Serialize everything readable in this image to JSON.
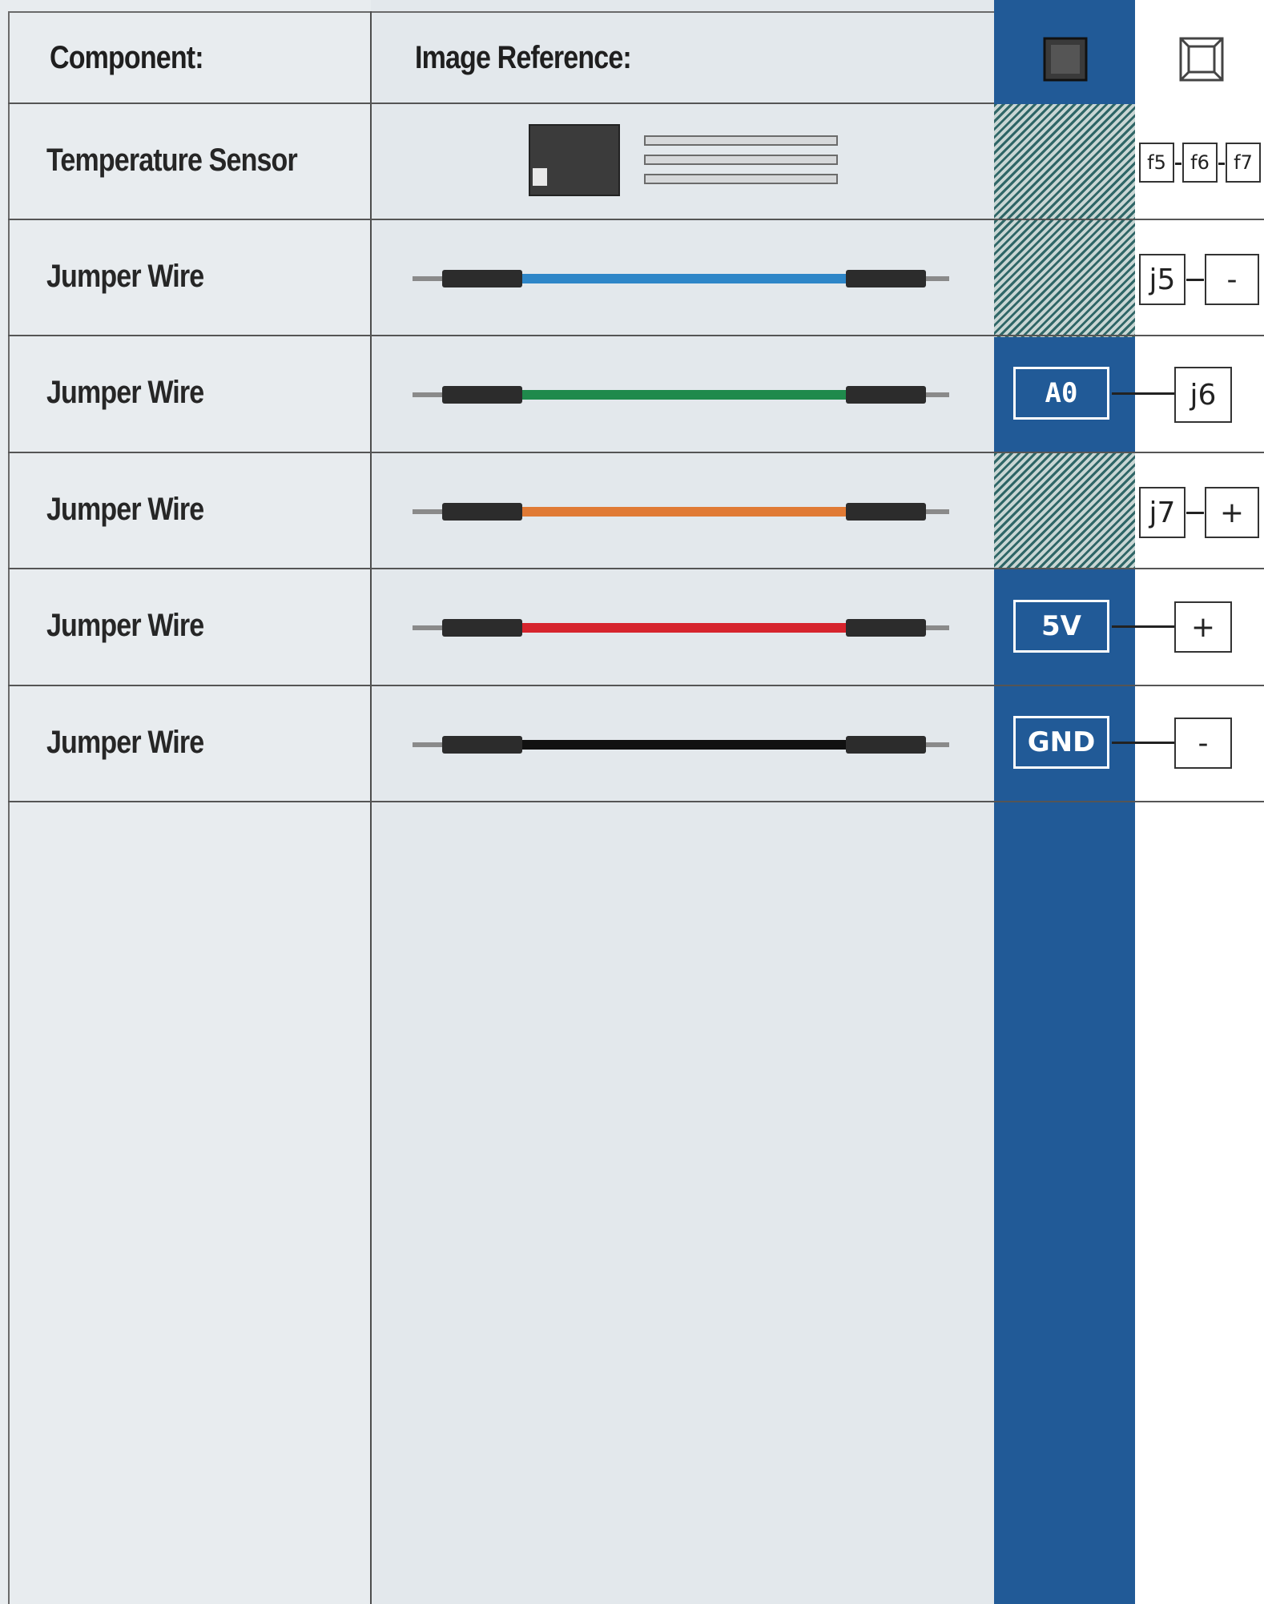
{
  "headers": {
    "component": "Component:",
    "image_reference": "Image Reference:"
  },
  "rows": [
    {
      "component": "Temperature Sensor",
      "image": "temperature-sensor"
    },
    {
      "component": "Jumper Wire",
      "wire_color": "#2e86c8",
      "arduino_pin": "",
      "breadboard": [
        "j5",
        "-"
      ]
    },
    {
      "component": "Jumper Wire",
      "wire_color": "#1f8a4c",
      "arduino_pin": "A0",
      "breadboard": [
        "j6"
      ]
    },
    {
      "component": "Jumper Wire",
      "wire_color": "#e07a35",
      "arduino_pin": "",
      "breadboard": [
        "j7",
        "+"
      ]
    },
    {
      "component": "Jumper Wire",
      "wire_color": "#d6242d",
      "arduino_pin": "5V",
      "breadboard": [
        "+"
      ]
    },
    {
      "component": "Jumper Wire",
      "wire_color": "#111111",
      "arduino_pin": "GND",
      "breadboard": [
        "-"
      ]
    }
  ],
  "sensor_breadboard": [
    "f5",
    "f6",
    "f7"
  ],
  "colors": {
    "arduino_column": "#215a97",
    "wire_blue": "#2e86c8",
    "wire_green": "#1f8a4c",
    "wire_orange": "#e07a35",
    "wire_red": "#d6242d",
    "wire_black": "#111111"
  }
}
